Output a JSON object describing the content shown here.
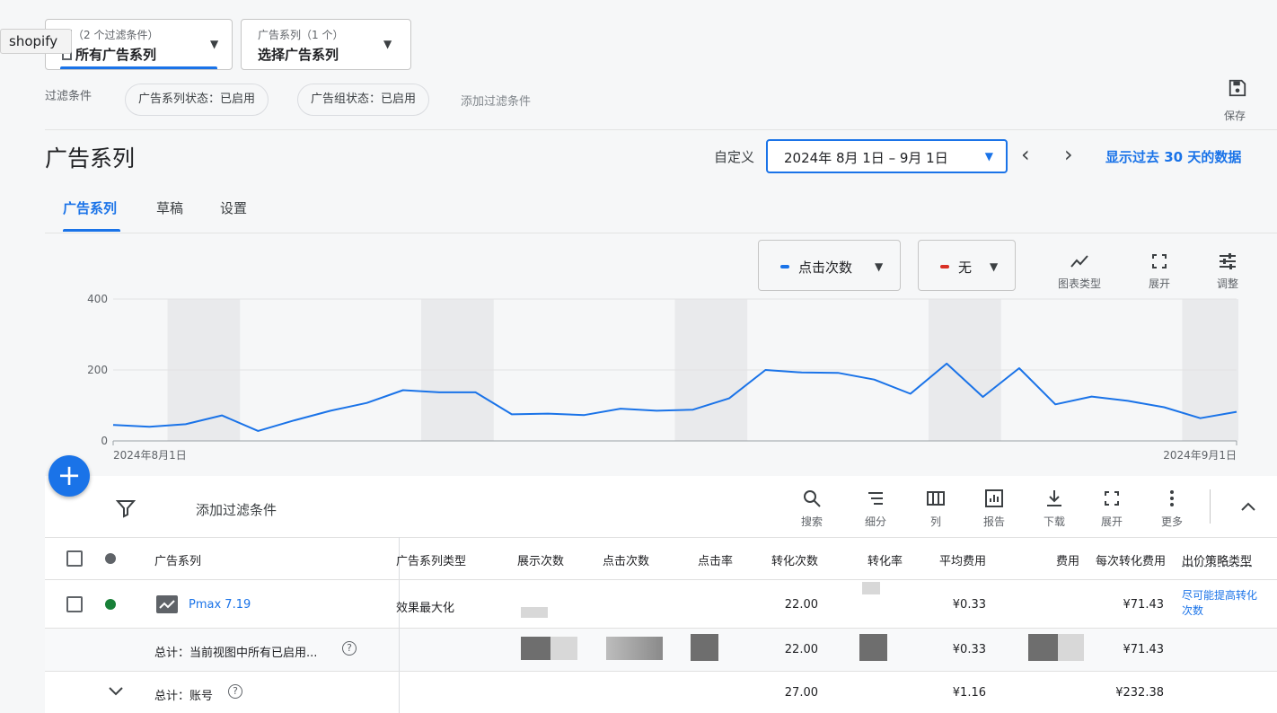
{
  "tooltip": "shopify",
  "view_selector": {
    "subtitle": "图（2 个过滤条件）",
    "value": "所有广告系列"
  },
  "campaign_selector": {
    "subtitle": "广告系列（1 个）",
    "value": "选择广告系列"
  },
  "filters": {
    "label": "过滤条件",
    "chips": [
      "广告系列状态：已启用",
      "广告组状态：已启用"
    ],
    "add": "添加过滤条件"
  },
  "save_label": "保存",
  "page_title": "广告系列",
  "date": {
    "custom_label": "自定义",
    "range": "2024年 8月 1日 – 9月 1日",
    "show_30": "显示过去 30 天的数据"
  },
  "tabs": [
    "广告系列",
    "草稿",
    "设置"
  ],
  "metric1": {
    "label": "点击次数",
    "color": "#1a73e8"
  },
  "metric2": {
    "label": "无",
    "color": "#d93025"
  },
  "chart_tools": [
    "图表类型",
    "展开",
    "调整"
  ],
  "chart_data": {
    "type": "line",
    "y_ticks": [
      "0",
      "200",
      "400"
    ],
    "ylim": [
      0,
      400
    ],
    "x_start_label": "2024年8月1日",
    "x_end_label": "2024年9月1日",
    "series": [
      {
        "values": [
          45,
          40,
          47,
          72,
          28,
          58,
          85,
          107,
          143,
          137,
          137,
          75,
          77,
          73,
          91,
          85,
          88,
          120,
          200,
          193,
          192,
          173,
          133,
          218,
          124,
          205,
          103,
          125,
          113,
          95,
          64,
          82
        ]
      }
    ]
  },
  "table_toolbar": {
    "add_filter": "添加过滤条件",
    "tools": [
      "搜索",
      "细分",
      "列",
      "报告",
      "下载",
      "展开",
      "更多"
    ]
  },
  "columns": [
    "广告系列",
    "广告系列类型",
    "展示次数",
    "点击次数",
    "点击率",
    "转化次数",
    "转化率",
    "平均费用",
    "费用",
    "每次转化费用",
    "出价策略类型"
  ],
  "rows": {
    "campaign": {
      "name": "Pmax 7.19",
      "type": "效果最大化",
      "conversions": "22.00",
      "avg_cost": "¥0.33",
      "cost_per_conv": "¥71.43",
      "bid_strategy": "尽可能提高转化次数"
    },
    "total_view": {
      "label": "总计：当前视图中所有已启用...",
      "conversions": "22.00",
      "avg_cost": "¥0.33",
      "cost_per_conv": "¥71.43"
    },
    "total_account": {
      "label": "总计：账号",
      "conversions": "27.00",
      "avg_cost": "¥1.16",
      "cost_per_conv": "¥232.38"
    }
  }
}
